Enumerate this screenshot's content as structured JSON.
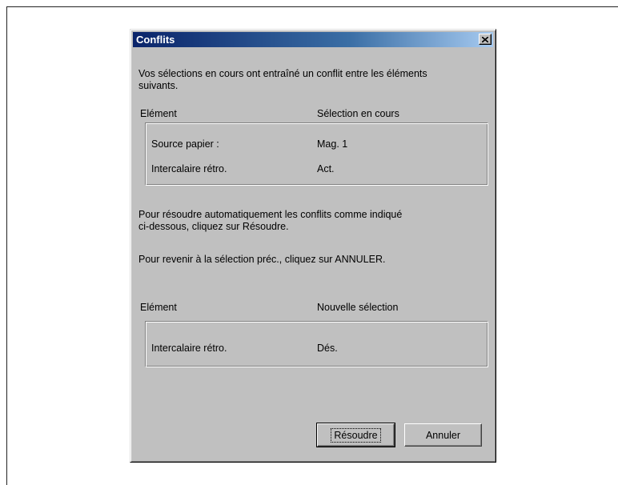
{
  "dialog": {
    "title": "Conflits",
    "intro_line1": "Vos sélections en cours ont entraîné un conflit entre les éléments",
    "intro_line2": "suivants.",
    "current": {
      "header_element": "Elément",
      "header_selection": "Sélection en cours",
      "rows": [
        {
          "element": "Source papier :",
          "value": "Mag. 1"
        },
        {
          "element": "Intercalaire rétro.",
          "value": "Act."
        }
      ]
    },
    "resolve_text_line1": "Pour résoudre automatiquement les conflits comme indiqué",
    "resolve_text_line2": "ci-dessous, cliquez sur Résoudre.",
    "cancel_text": "Pour revenir à la sélection préc., cliquez sur ANNULER.",
    "new": {
      "header_element": "Elément",
      "header_selection": "Nouvelle sélection",
      "rows": [
        {
          "element": "Intercalaire rétro.",
          "value": "Dés."
        }
      ]
    },
    "buttons": {
      "resolve": "Résoudre",
      "cancel": "Annuler"
    },
    "icons": {
      "close": "close-icon"
    }
  }
}
